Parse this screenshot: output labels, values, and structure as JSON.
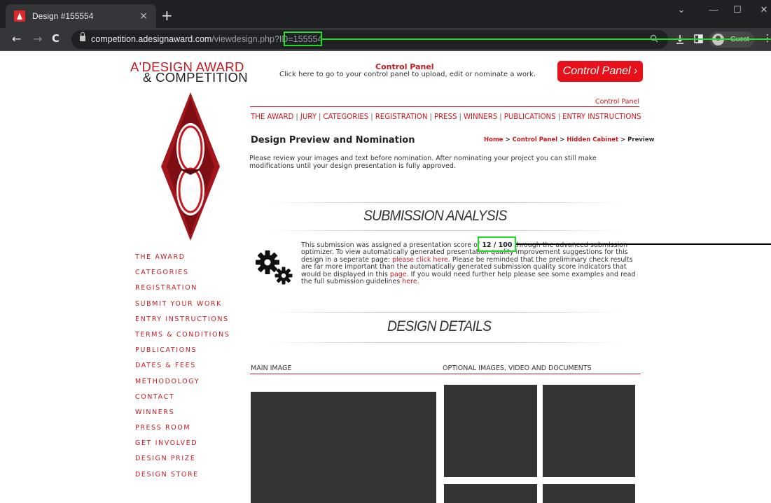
{
  "browser": {
    "tab_title": "Design #155554",
    "tab_close": "×",
    "new_tab": "+",
    "window_controls": {
      "minimize": "—",
      "maximize": "☐",
      "close": "✕",
      "dropdown": "⌄"
    },
    "nav": {
      "back": "←",
      "forward": "→",
      "reload": "C"
    },
    "url_host": "competition.adesignaward.com",
    "url_path": "/viewdesign.php?ID=",
    "url_id": "155554",
    "profile_label": "Guest",
    "menu": "⋮"
  },
  "header": {
    "logo_line1": "A'DESIGN AWARD",
    "logo_line2": "& COMPETITION",
    "cp_title": "Control Panel",
    "cp_desc": "Click here to go to your control panel to upload, edit or nominate a work.",
    "cp_button": "Control Panel ›",
    "cp_link": "Control Panel"
  },
  "topnav": [
    "THE AWARD",
    "JURY",
    "CATEGORIES",
    "REGISTRATION",
    "PRESS",
    "WINNERS",
    "PUBLICATIONS",
    "ENTRY INSTRUCTIONS"
  ],
  "main": {
    "heading": "Design Preview and Nomination",
    "breadcrumb": {
      "home": "Home",
      "sep": ">",
      "control_panel": "Control Panel",
      "hidden_cabinet": "Hidden Cabinet",
      "current": "Preview"
    },
    "intro": "Please review your images and text before nomination. After nominating your project you can still make modifications until your design presentation is fully approved.",
    "submission_title": "SUBMISSION ANALYSIS",
    "analysis": {
      "p1": "This submission was assigned a presentation score of ",
      "score": "12 / 100",
      "p2": " through the advanced submission optimizer. To view automatically generated presentation quality improvement suggestions for this design in a seperate page: ",
      "link1": "please click here",
      "p3": ". Please be reminded that the preliminary check results are far more important than the automatically generated submission quality score indicators that would be displayed in this ",
      "link2": "page",
      "p4": ". If you would need further help please see some examples and read the full submission guidelines ",
      "link3": "here",
      "p5": "."
    },
    "details_title": "DESIGN DETAILS",
    "main_image_label": "MAIN IMAGE",
    "optional_label": "OPTIONAL IMAGES, VIDEO AND DOCUMENTS"
  },
  "sidemenu": [
    "THE AWARD",
    "CATEGORIES",
    "REGISTRATION",
    "SUBMIT YOUR WORK",
    "ENTRY INSTRUCTIONS",
    "TERMS & CONDITIONS",
    "PUBLICATIONS",
    "DATES & FEES",
    "METHODOLOGY",
    "CONTACT",
    "WINNERS",
    "PRESS ROOM",
    "GET INVOLVED",
    "DESIGN PRIZE",
    "DESIGN STORE"
  ],
  "colors": {
    "brand_red": "#c8191f",
    "button_red": "#e8101a",
    "chrome_dark": "#202124",
    "annotation_green": "#22dd22",
    "placeholder_dark": "#333436"
  },
  "icons": [
    "adesign-favicon-icon",
    "lock-icon",
    "zoom-icon",
    "download-icon",
    "sidepanel-icon",
    "profile-icon",
    "gear-icon",
    "diamond-trophy-icon"
  ]
}
